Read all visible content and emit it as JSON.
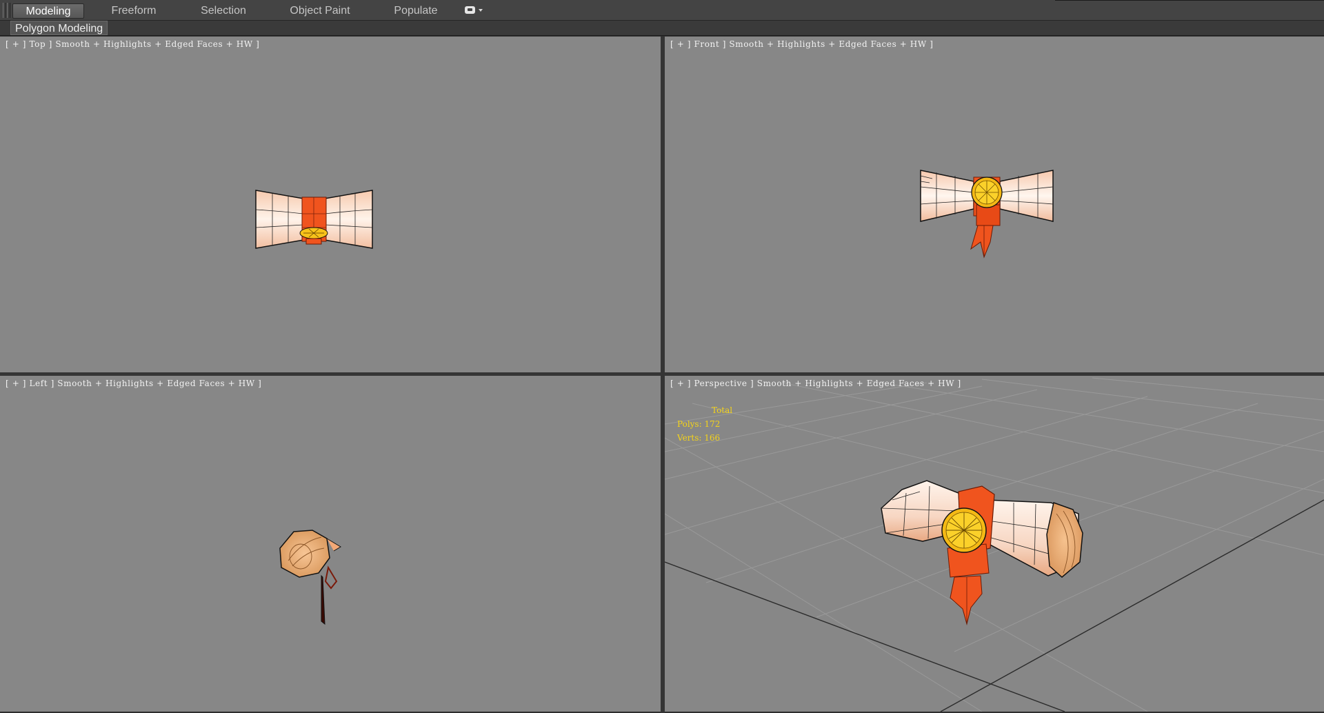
{
  "ribbon": {
    "tabs": [
      {
        "label": "Modeling",
        "active": true
      },
      {
        "label": "Freeform",
        "active": false
      },
      {
        "label": "Selection",
        "active": false
      },
      {
        "label": "Object Paint",
        "active": false
      },
      {
        "label": "Populate",
        "active": false
      }
    ],
    "more_icon": "toggle-icon",
    "panel_label": "Polygon Modeling"
  },
  "viewports": {
    "top": {
      "label": "[ + ] Top ] Smooth + Highlights + Edged Faces + HW ]"
    },
    "front": {
      "label": "[ + ] Front ] Smooth + Highlights + Edged Faces + HW ]"
    },
    "left": {
      "label": "[ + ] Left ] Smooth + Highlights + Edged Faces + HW ]"
    },
    "perspective": {
      "label": "[ + ] Perspective ] Smooth + Highlights + Edged Faces + HW ]",
      "stats": {
        "total": "Total",
        "polys": "Polys: 172",
        "verts": "Verts: 166"
      }
    }
  },
  "colors": {
    "viewport_bg": "#878787",
    "ribbon_bg": "#444444",
    "stats_text": "#f4d31a",
    "scroll_paper": "#f7d9c7",
    "ribbon_red": "#f0541e",
    "seal_gold": "#f7c21a"
  }
}
